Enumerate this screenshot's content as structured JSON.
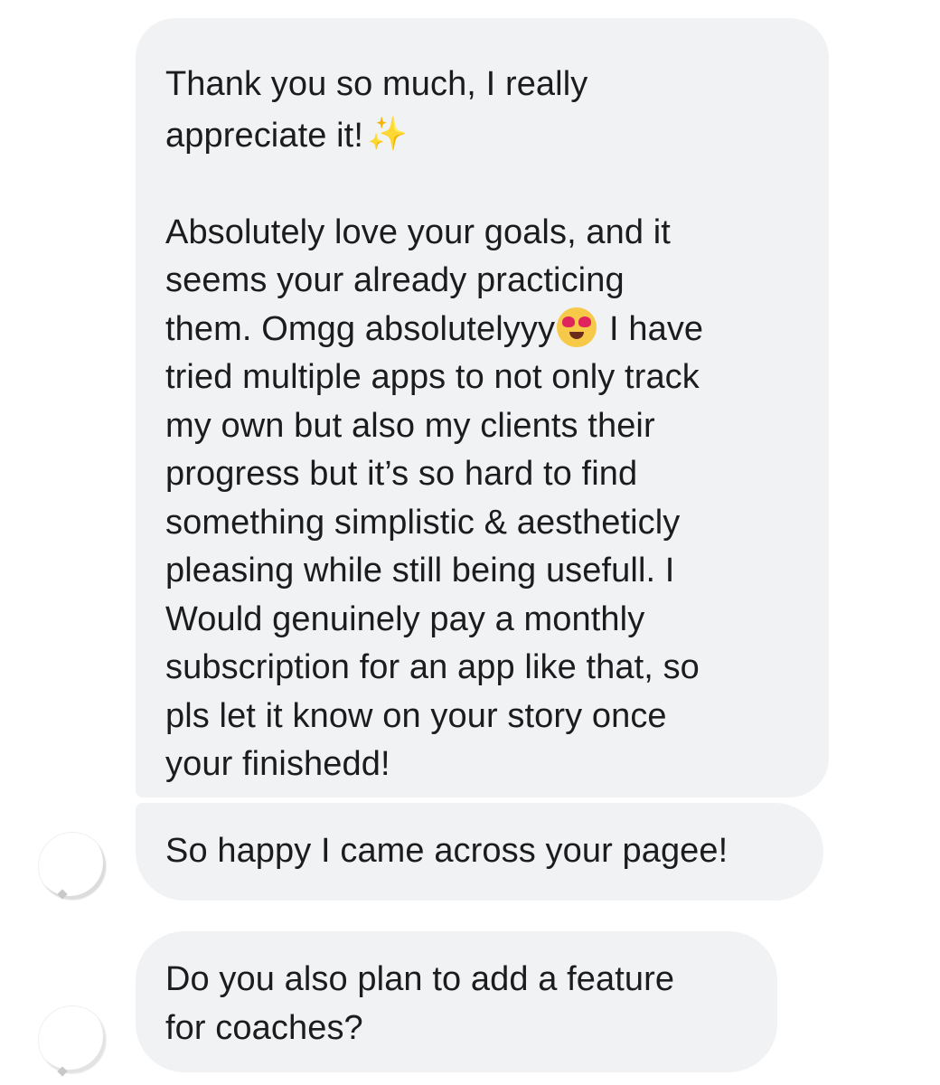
{
  "messages": [
    {
      "id": "msg1",
      "line1": "Thank you so much, I really",
      "line2": "appreciate it!",
      "sparkle_icon": "sparkles-icon",
      "body_before_emoji": "Absolutely love your goals, and it\nseems your already practicing\nthem.  Omgg absolutelyyy",
      "emoji_icon": "heart-eyes-emoji",
      "body_after_emoji": "I have\ntried multiple apps to not only track\nmy own but also my clients their\nprogress but it’s so hard to find\nsomething simplistic & aestheticly\npleasing while still being usefull. I\nWould genuinely pay a monthly\nsubscription for an app like that, so\npls let it know on your story once\nyour finishedd!"
    },
    {
      "id": "msg2",
      "text": "So happy I came across your pagee!"
    },
    {
      "id": "msg3",
      "text": "Do you also plan to add a feature\nfor coaches?"
    }
  ],
  "colors": {
    "bubble_bg": "#f1f2f4",
    "text": "#1c1c1e",
    "sparkle": "#f2c94c",
    "emoji_face": "#f7c948",
    "emoji_hearts": "#e0245e"
  }
}
